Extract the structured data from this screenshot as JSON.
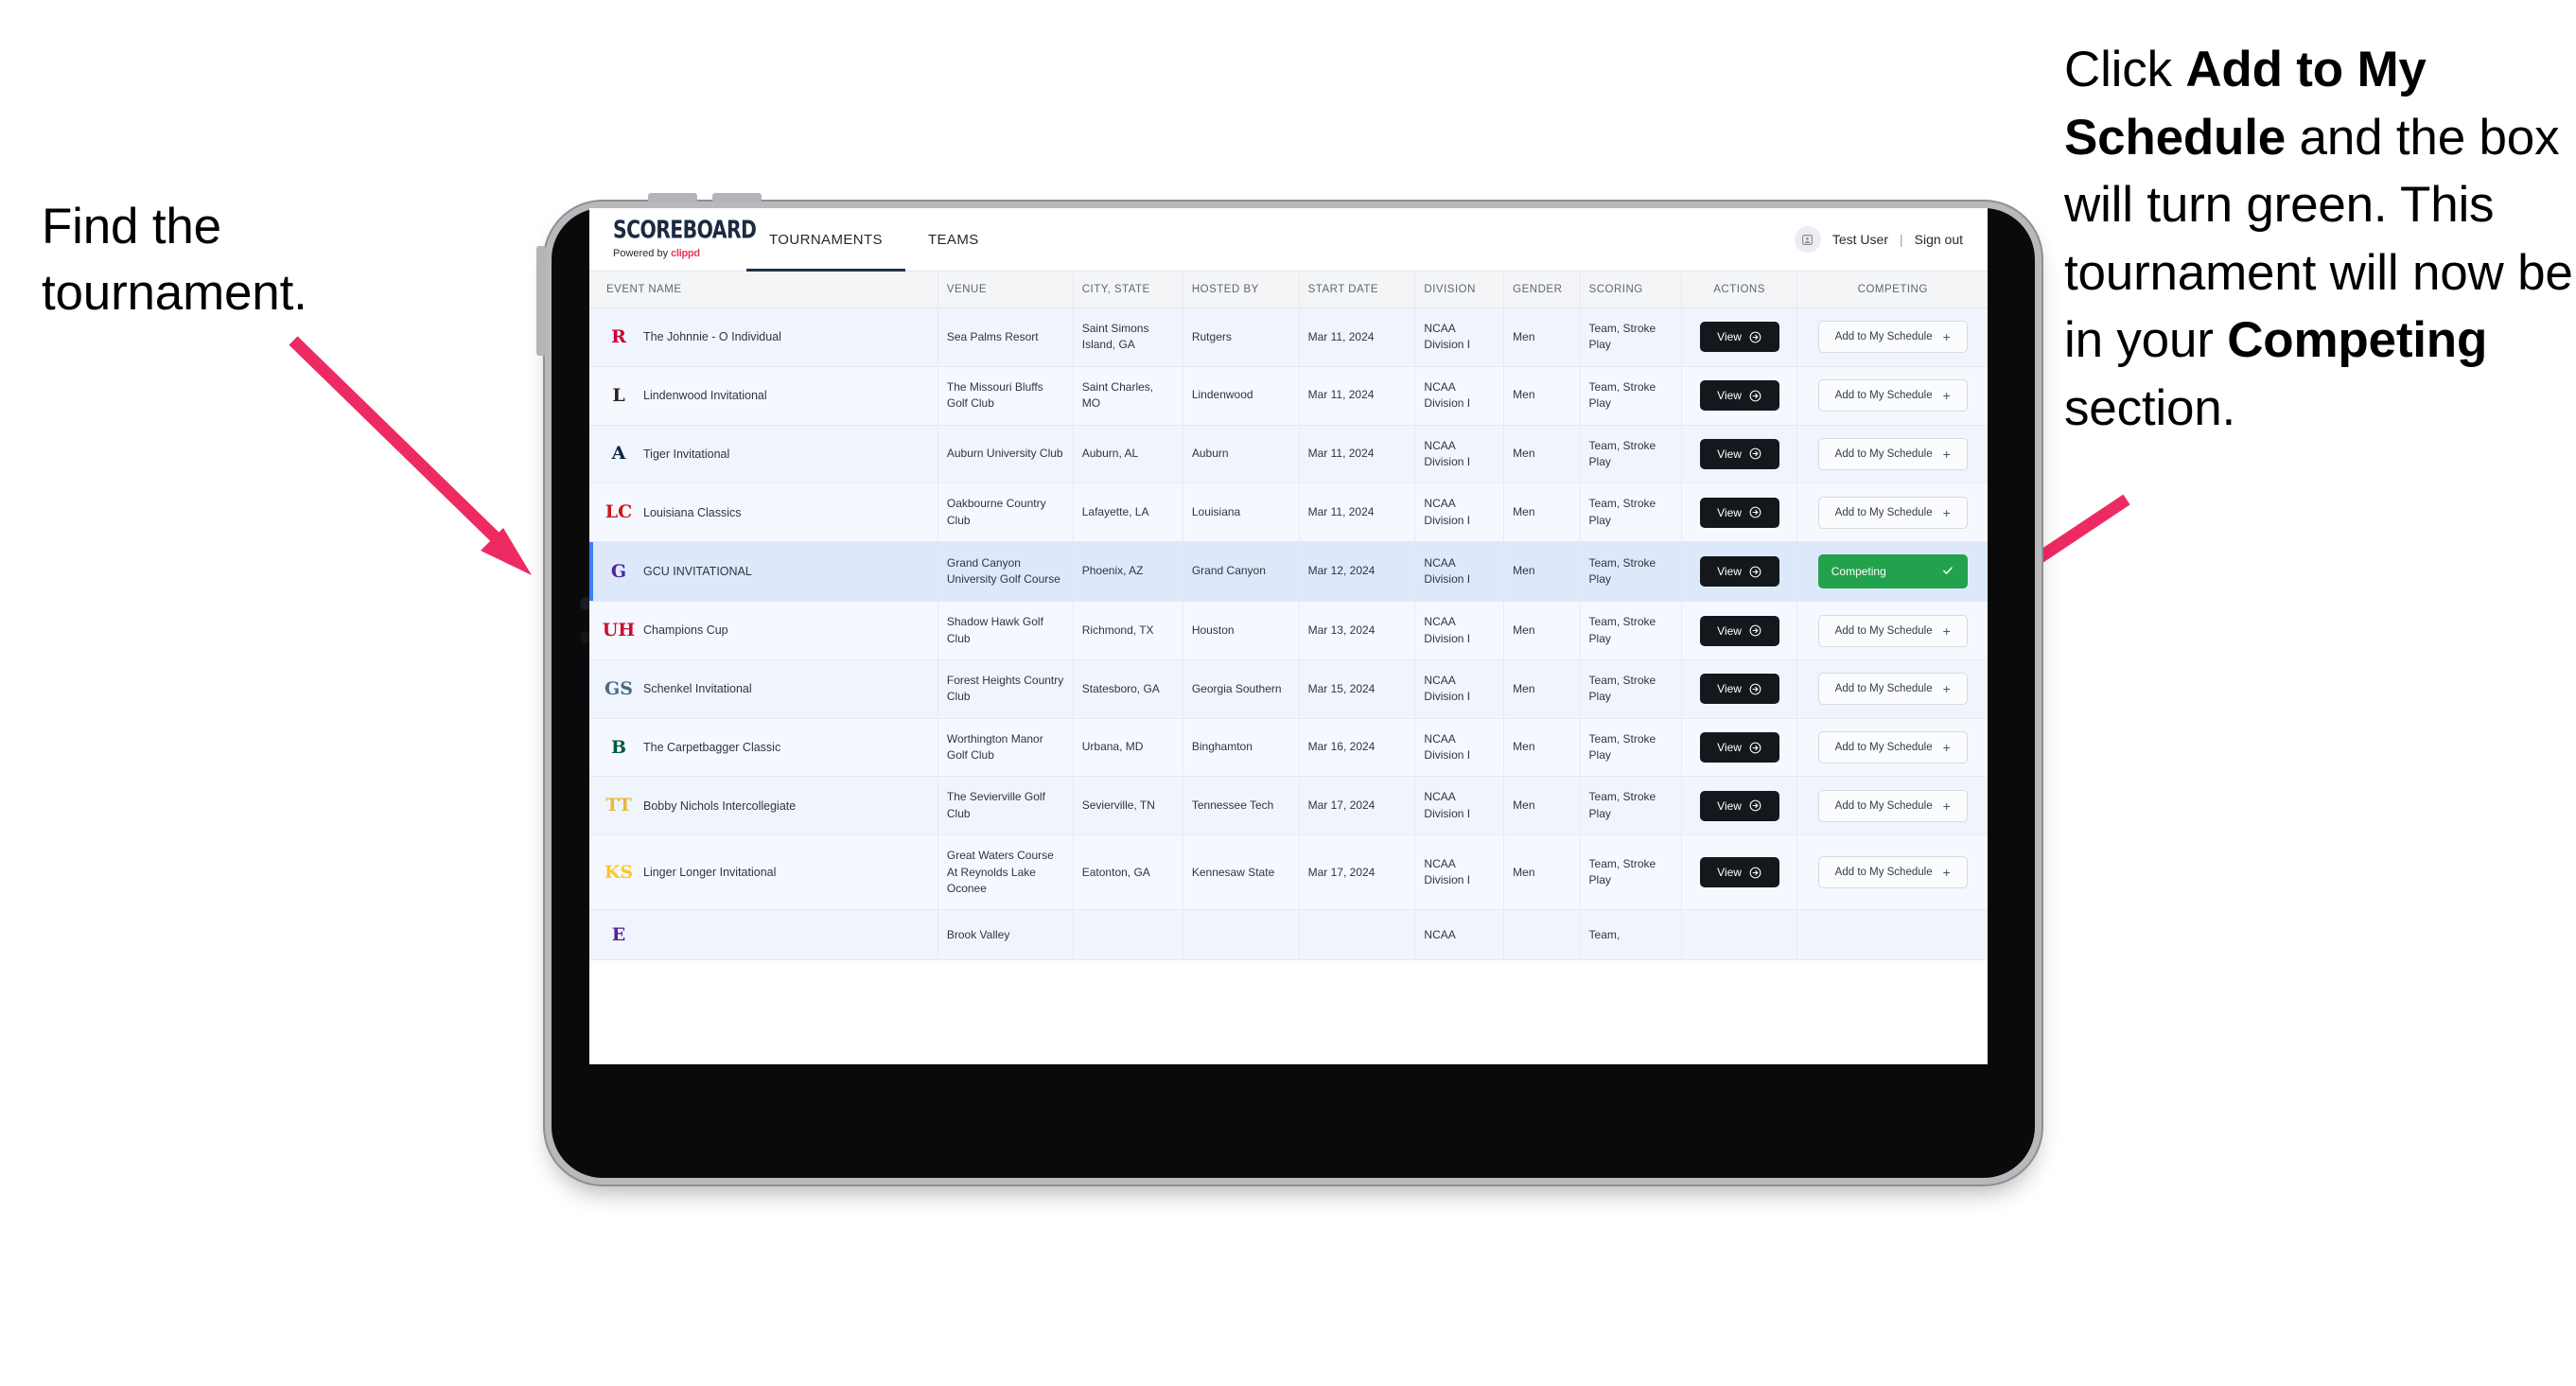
{
  "annotations": {
    "left": "Find the tournament.",
    "right_parts": [
      {
        "text": "Click ",
        "bold": false
      },
      {
        "text": "Add to My Schedule",
        "bold": true
      },
      {
        "text": " and the box will turn green. This tournament will now be in your ",
        "bold": false
      },
      {
        "text": "Competing",
        "bold": true
      },
      {
        "text": " section.",
        "bold": false
      }
    ],
    "arrow_color": "#ee2a62"
  },
  "app": {
    "brand": {
      "title": "SCOREBOARD",
      "powered_prefix": "Powered by ",
      "powered_brand": "clippd"
    },
    "tabs": [
      {
        "label": "TOURNAMENTS",
        "active": true
      },
      {
        "label": "TEAMS",
        "active": false
      }
    ],
    "account": {
      "avatar_icon": "user-avatar-icon",
      "user_name": "Test User",
      "separator": "|",
      "sign_out": "Sign out"
    }
  },
  "table": {
    "columns": [
      "EVENT NAME",
      "VENUE",
      "CITY, STATE",
      "HOSTED BY",
      "START DATE",
      "DIVISION",
      "GENDER",
      "SCORING",
      "ACTIONS",
      "COMPETING"
    ],
    "buttons": {
      "view": "View",
      "view_icon": "circle-arrow-right-icon",
      "add": "Add to My Schedule",
      "add_icon": "plus-icon",
      "competing": "Competing",
      "competing_icon": "check-icon"
    },
    "rows": [
      {
        "logo": {
          "text": "R",
          "color": "#cc0033",
          "bg": "transparent",
          "name": "rutgers-logo"
        },
        "event": "The Johnnie - O Individual",
        "venue": "Sea Palms Resort",
        "city": "Saint Simons Island, GA",
        "host": "Rutgers",
        "date": "Mar 11, 2024",
        "division": "NCAA Division I",
        "gender": "Men",
        "scoring": "Team, Stroke Play",
        "competing": false
      },
      {
        "logo": {
          "text": "L",
          "color": "#2a2118",
          "bg": "transparent",
          "name": "lindenwood-logo"
        },
        "event": "Lindenwood Invitational",
        "venue": "The Missouri Bluffs Golf Club",
        "city": "Saint Charles, MO",
        "host": "Lindenwood",
        "date": "Mar 11, 2024",
        "division": "NCAA Division I",
        "gender": "Men",
        "scoring": "Team, Stroke Play",
        "competing": false
      },
      {
        "logo": {
          "text": "A",
          "color": "#0c2340",
          "bg": "transparent",
          "name": "auburn-logo"
        },
        "event": "Tiger Invitational",
        "venue": "Auburn University Club",
        "city": "Auburn, AL",
        "host": "Auburn",
        "date": "Mar 11, 2024",
        "division": "NCAA Division I",
        "gender": "Men",
        "scoring": "Team, Stroke Play",
        "competing": false
      },
      {
        "logo": {
          "text": "LC",
          "color": "#ce181e",
          "bg": "transparent",
          "name": "louisiana-ragin-cajuns-logo"
        },
        "event": "Louisiana Classics",
        "venue": "Oakbourne Country Club",
        "city": "Lafayette, LA",
        "host": "Louisiana",
        "date": "Mar 11, 2024",
        "division": "NCAA Division I",
        "gender": "Men",
        "scoring": "Team, Stroke Play",
        "competing": false
      },
      {
        "logo": {
          "text": "G",
          "color": "#522398",
          "bg": "transparent",
          "name": "grand-canyon-lopes-logo"
        },
        "event": "GCU INVITATIONAL",
        "venue": "Grand Canyon University Golf Course",
        "city": "Phoenix, AZ",
        "host": "Grand Canyon",
        "date": "Mar 12, 2024",
        "division": "NCAA Division I",
        "gender": "Men",
        "scoring": "Team, Stroke Play",
        "competing": true,
        "selected": true
      },
      {
        "logo": {
          "text": "UH",
          "color": "#c8102e",
          "bg": "transparent",
          "name": "houston-cougars-logo"
        },
        "event": "Champions Cup",
        "venue": "Shadow Hawk Golf Club",
        "city": "Richmond, TX",
        "host": "Houston",
        "date": "Mar 13, 2024",
        "division": "NCAA Division I",
        "gender": "Men",
        "scoring": "Team, Stroke Play",
        "competing": false
      },
      {
        "logo": {
          "text": "GS",
          "color": "#4a6a82",
          "bg": "transparent",
          "name": "georgia-southern-logo"
        },
        "event": "Schenkel Invitational",
        "venue": "Forest Heights Country Club",
        "city": "Statesboro, GA",
        "host": "Georgia Southern",
        "date": "Mar 15, 2024",
        "division": "NCAA Division I",
        "gender": "Men",
        "scoring": "Team, Stroke Play",
        "competing": false
      },
      {
        "logo": {
          "text": "B",
          "color": "#005a43",
          "bg": "transparent",
          "name": "binghamton-bearcats-logo"
        },
        "event": "The Carpetbagger Classic",
        "venue": "Worthington Manor Golf Club",
        "city": "Urbana, MD",
        "host": "Binghamton",
        "date": "Mar 16, 2024",
        "division": "NCAA Division I",
        "gender": "Men",
        "scoring": "Team, Stroke Play",
        "competing": false
      },
      {
        "logo": {
          "text": "TT",
          "color": "#e5b838",
          "bg": "transparent",
          "name": "tennessee-tech-golden-eagles-logo"
        },
        "event": "Bobby Nichols Intercollegiate",
        "venue": "The Sevierville Golf Club",
        "city": "Sevierville, TN",
        "host": "Tennessee Tech",
        "date": "Mar 17, 2024",
        "division": "NCAA Division I",
        "gender": "Men",
        "scoring": "Team, Stroke Play",
        "competing": false
      },
      {
        "logo": {
          "text": "KS",
          "color": "#ffc629",
          "bg": "transparent",
          "name": "kennesaw-state-owls-logo"
        },
        "event": "Linger Longer Invitational",
        "venue": "Great Waters Course At Reynolds Lake Oconee",
        "city": "Eatonton, GA",
        "host": "Kennesaw State",
        "date": "Mar 17, 2024",
        "division": "NCAA Division I",
        "gender": "Men",
        "scoring": "Team, Stroke Play",
        "competing": false
      },
      {
        "logo": {
          "text": "E",
          "color": "#522398",
          "bg": "transparent",
          "name": "east-carolina-pirates-logo"
        },
        "event": "",
        "venue": "Brook Valley",
        "city": "",
        "host": "",
        "date": "",
        "division": "NCAA",
        "gender": "",
        "scoring": "Team,",
        "competing": false,
        "partial": true
      }
    ]
  }
}
